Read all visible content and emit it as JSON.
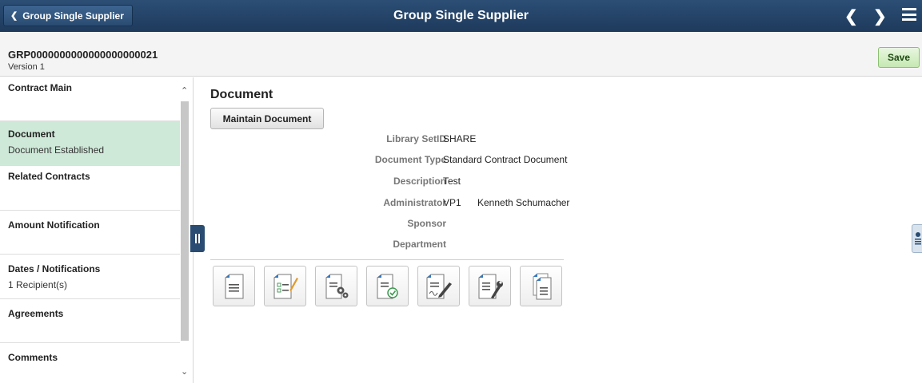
{
  "header": {
    "back_label": "Group Single Supplier",
    "title": "Group Single Supplier"
  },
  "contract": {
    "id": "GRP0000000000000000000021",
    "version": "Version 1",
    "save_label": "Save"
  },
  "sidebar": {
    "items": [
      {
        "label": "Contract Main",
        "sub": ""
      },
      {
        "label": "Document",
        "sub": "Document Established"
      },
      {
        "label": "Related Contracts",
        "sub": ""
      },
      {
        "label": "Amount Notification",
        "sub": ""
      },
      {
        "label": "Dates / Notifications",
        "sub": "1 Recipient(s)"
      },
      {
        "label": "Agreements",
        "sub": ""
      },
      {
        "label": "Comments",
        "sub": ""
      }
    ]
  },
  "document": {
    "section_title": "Document",
    "maintain_label": "Maintain Document",
    "fields": {
      "library_setid": {
        "label": "Library SetID",
        "value": "SHARE"
      },
      "document_type": {
        "label": "Document Type",
        "value": "Standard Contract Document"
      },
      "description": {
        "label": "Description",
        "value": "Test"
      },
      "administrator": {
        "label": "Administrator",
        "value": "VP1",
        "name": "Kenneth Schumacher"
      },
      "sponsor": {
        "label": "Sponsor",
        "value": ""
      },
      "department": {
        "label": "Department",
        "value": ""
      }
    },
    "action_icons": [
      "view-document-icon",
      "document-checklist-icon",
      "document-settings-icon",
      "document-approve-icon",
      "document-sign-icon",
      "document-tools-icon",
      "document-copy-icon"
    ]
  },
  "colors": {
    "header_bg": "#1e3a5c",
    "active_item_bg": "#cfe9d8",
    "save_btn_bg": "#c6e8b3",
    "icon_blue": "#2f78c4"
  }
}
